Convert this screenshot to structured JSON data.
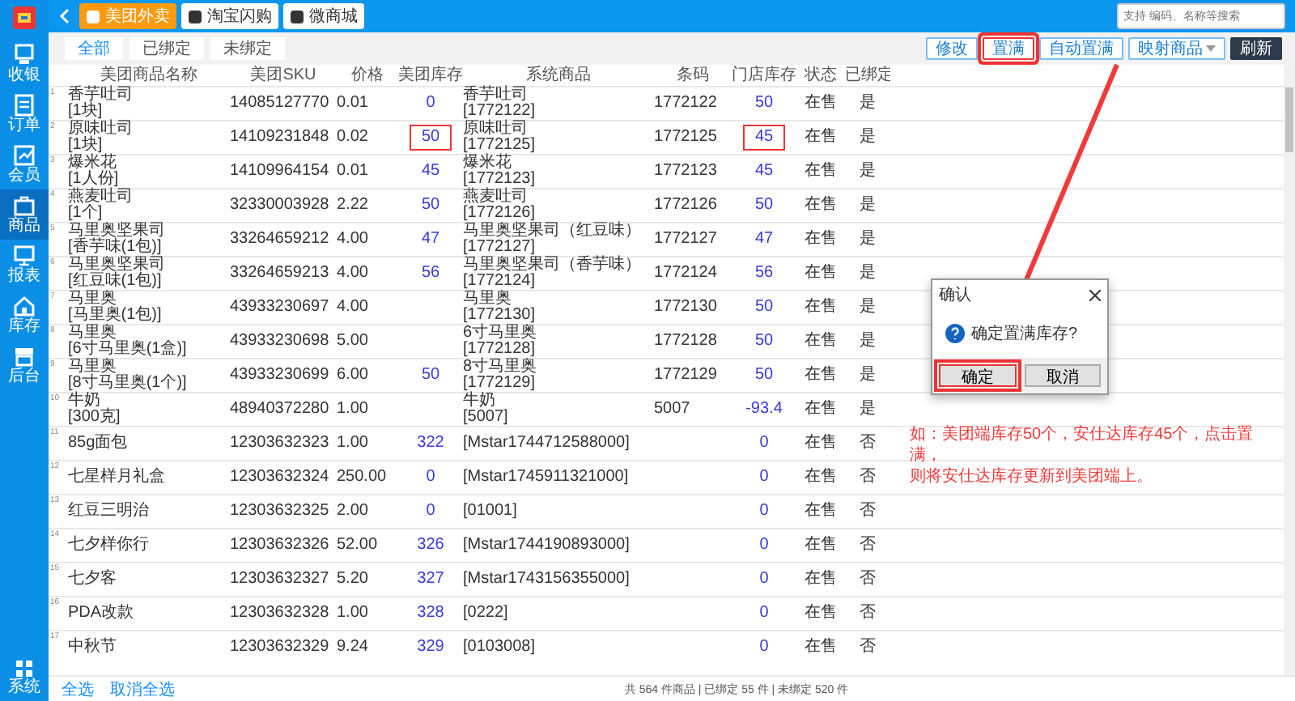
{
  "sidebar": {
    "items": [
      {
        "label": "收银",
        "selected": false
      },
      {
        "label": "订单",
        "selected": false
      },
      {
        "label": "会员",
        "selected": false
      },
      {
        "label": "商品",
        "selected": true
      },
      {
        "label": "报表",
        "selected": false
      },
      {
        "label": "库存",
        "selected": false
      },
      {
        "label": "后台",
        "selected": false
      }
    ],
    "bottom_item": {
      "label": "系统"
    }
  },
  "platform_tabs": [
    {
      "label": "美团外卖",
      "selected": true
    },
    {
      "label": "淘宝闪购",
      "selected": false
    },
    {
      "label": "微商城",
      "selected": false
    }
  ],
  "search": {
    "placeholder": "支持 编码、名称等搜索"
  },
  "filter_tabs": [
    {
      "label": "全部",
      "selected": true
    },
    {
      "label": "已绑定",
      "selected": false
    },
    {
      "label": "未绑定",
      "selected": false
    }
  ],
  "actions": [
    {
      "label": "修改",
      "kind": "outline",
      "highlighted": false
    },
    {
      "label": "置满",
      "kind": "outline",
      "highlighted": true
    },
    {
      "label": "自动置满",
      "kind": "outline",
      "highlighted": false
    },
    {
      "label": "映射商品",
      "kind": "dropdown",
      "highlighted": false
    },
    {
      "label": "刷新",
      "kind": "primary",
      "highlighted": false
    }
  ],
  "table": {
    "columns": [
      "美团商品名称",
      "美团SKU",
      "价格",
      "美团库存",
      "系统商品",
      "条码",
      "门店库存",
      "状态",
      "已绑定"
    ],
    "rows": [
      {
        "no": "1",
        "name": "香芋吐司",
        "spec": "[1块]",
        "sku": "14085127770",
        "price": "0.01",
        "mt_stock": "0",
        "sys_name": "香芋吐司",
        "sys_code": "[1772122]",
        "barcode": "1772122",
        "store_stock": "50",
        "status": "在售",
        "bound": "是",
        "highlighted": false
      },
      {
        "no": "2",
        "name": "原味吐司",
        "spec": "[1块]",
        "sku": "14109231848",
        "price": "0.02",
        "mt_stock": "50",
        "sys_name": "原味吐司",
        "sys_code": "[1772125]",
        "barcode": "1772125",
        "store_stock": "45",
        "status": "在售",
        "bound": "是",
        "highlighted": true
      },
      {
        "no": "3",
        "name": "爆米花",
        "spec": "[1人份]",
        "sku": "14109964154",
        "price": "0.01",
        "mt_stock": "45",
        "sys_name": "爆米花",
        "sys_code": "[1772123]",
        "barcode": "1772123",
        "store_stock": "45",
        "status": "在售",
        "bound": "是",
        "highlighted": false
      },
      {
        "no": "4",
        "name": "燕麦吐司",
        "spec": "[1个]",
        "sku": "32330003928",
        "price": "2.22",
        "mt_stock": "50",
        "sys_name": "燕麦吐司",
        "sys_code": "[1772126]",
        "barcode": "1772126",
        "store_stock": "50",
        "status": "在售",
        "bound": "是",
        "highlighted": false
      },
      {
        "no": "5",
        "name": "马里奥坚果司",
        "spec": "[香芋味(1包)]",
        "sku": "33264659212",
        "price": "4.00",
        "mt_stock": "47",
        "sys_name": "马里奥坚果司（红豆味）",
        "sys_code": "[1772127]",
        "barcode": "1772127",
        "store_stock": "47",
        "status": "在售",
        "bound": "是",
        "highlighted": false
      },
      {
        "no": "6",
        "name": "马里奥坚果司",
        "spec": "[红豆味(1包)]",
        "sku": "33264659213",
        "price": "4.00",
        "mt_stock": "56",
        "sys_name": "马里奥坚果司（香芋味）",
        "sys_code": "[1772124]",
        "barcode": "1772124",
        "store_stock": "56",
        "status": "在售",
        "bound": "是",
        "highlighted": false
      },
      {
        "no": "7",
        "name": "马里奥",
        "spec": "[马里奥(1包)]",
        "sku": "43933230697",
        "price": "4.00",
        "sys_name": "马里奥",
        "sys_code": "[1772130]",
        "barcode": "1772130",
        "store_stock": "50",
        "status": "在售",
        "bound": "是",
        "highlighted": false
      },
      {
        "no": "8",
        "name": "马里奥",
        "spec": "[6寸马里奥(1盒)]",
        "sku": "43933230698",
        "price": "5.00",
        "sys_name": "6寸马里奥",
        "sys_code": "[1772128]",
        "barcode": "1772128",
        "store_stock": "50",
        "status": "在售",
        "bound": "是",
        "highlighted": false
      },
      {
        "no": "9",
        "name": "马里奥",
        "spec": "[8寸马里奥(1个)]",
        "sku": "43933230699",
        "price": "6.00",
        "mt_stock": "50",
        "sys_name": "8寸马里奥",
        "sys_code": "[1772129]",
        "barcode": "1772129",
        "store_stock": "50",
        "status": "在售",
        "bound": "是",
        "highlighted": false
      },
      {
        "no": "10",
        "name": "牛奶",
        "spec": "[300克]",
        "sku": "48940372280",
        "price": "1.00",
        "sys_name": "牛奶",
        "sys_code": "[5007]",
        "barcode": "5007",
        "store_stock": "-93.4",
        "status": "在售",
        "bound": "是",
        "highlighted": false
      },
      {
        "no": "11",
        "name": "85g面包",
        "sku": "12303632323",
        "price": "1.00",
        "mt_stock": "322",
        "sys_code": "[Mstar1744712588000]",
        "store_stock": "0",
        "status": "在售",
        "bound": "否",
        "highlighted": false
      },
      {
        "no": "12",
        "name": "七星样月礼盒",
        "sku": "12303632324",
        "price": "250.00",
        "mt_stock": "0",
        "sys_code": "[Mstar1745911321000]",
        "store_stock": "0",
        "status": "在售",
        "bound": "否",
        "highlighted": false
      },
      {
        "no": "13",
        "name": "红豆三明治",
        "sku": "12303632325",
        "price": "2.00",
        "mt_stock": "0",
        "sys_code": "[01001]",
        "store_stock": "0",
        "status": "在售",
        "bound": "否",
        "highlighted": false
      },
      {
        "no": "14",
        "name": "七夕样你行",
        "sku": "12303632326",
        "price": "52.00",
        "mt_stock": "326",
        "sys_code": "[Mstar1744190893000]",
        "store_stock": "0",
        "status": "在售",
        "bound": "否",
        "highlighted": false
      },
      {
        "no": "15",
        "name": "七夕客",
        "sku": "12303632327",
        "price": "5.20",
        "mt_stock": "327",
        "sys_code": "[Mstar1743156355000]",
        "store_stock": "0",
        "status": "在售",
        "bound": "否",
        "highlighted": false
      },
      {
        "no": "16",
        "name": "PDA改款",
        "sku": "12303632328",
        "price": "1.00",
        "mt_stock": "328",
        "sys_code": "[0222]",
        "store_stock": "0",
        "status": "在售",
        "bound": "否",
        "highlighted": false
      },
      {
        "no": "17",
        "name": "中秋节",
        "sku": "12303632329",
        "price": "9.24",
        "mt_stock": "329",
        "sys_code": "[0103008]",
        "store_stock": "0",
        "status": "在售",
        "bound": "否",
        "highlighted": false
      }
    ]
  },
  "dialog": {
    "title": "确认",
    "message": "确定置满库存?",
    "buttons": [
      {
        "label": "确定",
        "highlighted": true
      },
      {
        "label": "取消",
        "highlighted": false
      }
    ]
  },
  "annotation": {
    "lines": [
      "如：美团端库存50个，安仕达库存45个，点击置满，",
      "则将安仕达库存更新到美团端上。"
    ]
  },
  "footer": {
    "links": [
      "全选",
      "取消全选"
    ],
    "summary": "共 564 件商品 | 已绑定 55 件 | 未绑定 520 件"
  }
}
